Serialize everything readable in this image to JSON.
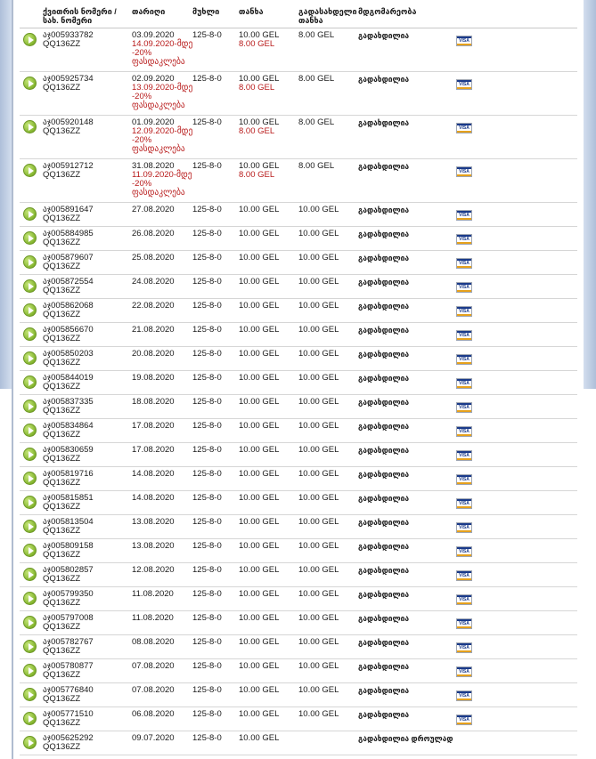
{
  "headers": {
    "number": "ქვითრის ნომერი /",
    "number2": "სახ. ნომერი",
    "date": "თარიღი",
    "route": "მუხლი",
    "amount": "თანხა",
    "paid": "გადასახდელი",
    "paid2": "თანხა",
    "status": "მდგომარეობა"
  },
  "rows": [
    {
      "receipt": "აჯ005933782",
      "plate": "QQ136ZZ",
      "date": "03.09.2020",
      "discount_until": "14.09.2020-მდე",
      "discount": "-20%",
      "discount_label": "ფასდაკლება",
      "route": "125-8-0",
      "amount": "10.00 GEL",
      "discounted_amount": "8.00 GEL",
      "paid": "8.00 GEL",
      "status": "გადახდილია",
      "card": "VISA"
    },
    {
      "receipt": "აჯ005925734",
      "plate": "QQ136ZZ",
      "date": "02.09.2020",
      "discount_until": "13.09.2020-მდე",
      "discount": "-20%",
      "discount_label": "ფასდაკლება",
      "route": "125-8-0",
      "amount": "10.00 GEL",
      "discounted_amount": "8.00 GEL",
      "paid": "8.00 GEL",
      "status": "გადახდილია",
      "card": "VISA"
    },
    {
      "receipt": "აჯ005920148",
      "plate": "QQ136ZZ",
      "date": "01.09.2020",
      "discount_until": "12.09.2020-მდე",
      "discount": "-20%",
      "discount_label": "ფასდაკლება",
      "route": "125-8-0",
      "amount": "10.00 GEL",
      "discounted_amount": "8.00 GEL",
      "paid": "8.00 GEL",
      "status": "გადახდილია",
      "card": "VISA"
    },
    {
      "receipt": "აჯ005912712",
      "plate": "QQ136ZZ",
      "date": "31.08.2020",
      "discount_until": "11.09.2020-მდე",
      "discount": "-20%",
      "discount_label": "ფასდაკლება",
      "route": "125-8-0",
      "amount": "10.00 GEL",
      "discounted_amount": "8.00 GEL",
      "paid": "8.00 GEL",
      "status": "გადახდილია",
      "card": "VISA"
    },
    {
      "receipt": "აჯ005891647",
      "plate": "QQ136ZZ",
      "date": "27.08.2020",
      "route": "125-8-0",
      "amount": "10.00 GEL",
      "paid": "10.00 GEL",
      "status": "გადახდილია",
      "card": "VISA"
    },
    {
      "receipt": "აჯ005884985",
      "plate": "QQ136ZZ",
      "date": "26.08.2020",
      "route": "125-8-0",
      "amount": "10.00 GEL",
      "paid": "10.00 GEL",
      "status": "გადახდილია",
      "card": "VISA"
    },
    {
      "receipt": "აჯ005879607",
      "plate": "QQ136ZZ",
      "date": "25.08.2020",
      "route": "125-8-0",
      "amount": "10.00 GEL",
      "paid": "10.00 GEL",
      "status": "გადახდილია",
      "card": "VISA"
    },
    {
      "receipt": "აჯ005872554",
      "plate": "QQ136ZZ",
      "date": "24.08.2020",
      "route": "125-8-0",
      "amount": "10.00 GEL",
      "paid": "10.00 GEL",
      "status": "გადახდილია",
      "card": "VISA"
    },
    {
      "receipt": "აჯ005862068",
      "plate": "QQ136ZZ",
      "date": "22.08.2020",
      "route": "125-8-0",
      "amount": "10.00 GEL",
      "paid": "10.00 GEL",
      "status": "გადახდილია",
      "card": "VISA"
    },
    {
      "receipt": "აჯ005856670",
      "plate": "QQ136ZZ",
      "date": "21.08.2020",
      "route": "125-8-0",
      "amount": "10.00 GEL",
      "paid": "10.00 GEL",
      "status": "გადახდილია",
      "card": "VISA"
    },
    {
      "receipt": "აჯ005850203",
      "plate": "QQ136ZZ",
      "date": "20.08.2020",
      "route": "125-8-0",
      "amount": "10.00 GEL",
      "paid": "10.00 GEL",
      "status": "გადახდილია",
      "card": "VISA"
    },
    {
      "receipt": "აჯ005844019",
      "plate": "QQ136ZZ",
      "date": "19.08.2020",
      "route": "125-8-0",
      "amount": "10.00 GEL",
      "paid": "10.00 GEL",
      "status": "გადახდილია",
      "card": "VISA"
    },
    {
      "receipt": "აჯ005837335",
      "plate": "QQ136ZZ",
      "date": "18.08.2020",
      "route": "125-8-0",
      "amount": "10.00 GEL",
      "paid": "10.00 GEL",
      "status": "გადახდილია",
      "card": "VISA"
    },
    {
      "receipt": "აჯ005834864",
      "plate": "QQ136ZZ",
      "date": "17.08.2020",
      "route": "125-8-0",
      "amount": "10.00 GEL",
      "paid": "10.00 GEL",
      "status": "გადახდილია",
      "card": "VISA"
    },
    {
      "receipt": "აჯ005830659",
      "plate": "QQ136ZZ",
      "date": "17.08.2020",
      "route": "125-8-0",
      "amount": "10.00 GEL",
      "paid": "10.00 GEL",
      "status": "გადახდილია",
      "card": "VISA"
    },
    {
      "receipt": "აჯ005819716",
      "plate": "QQ136ZZ",
      "date": "14.08.2020",
      "route": "125-8-0",
      "amount": "10.00 GEL",
      "paid": "10.00 GEL",
      "status": "გადახდილია",
      "card": "VISA"
    },
    {
      "receipt": "აჯ005815851",
      "plate": "QQ136ZZ",
      "date": "14.08.2020",
      "route": "125-8-0",
      "amount": "10.00 GEL",
      "paid": "10.00 GEL",
      "status": "გადახდილია",
      "card": "VISA"
    },
    {
      "receipt": "აჯ005813504",
      "plate": "QQ136ZZ",
      "date": "13.08.2020",
      "route": "125-8-0",
      "amount": "10.00 GEL",
      "paid": "10.00 GEL",
      "status": "გადახდილია",
      "card": "VISA"
    },
    {
      "receipt": "აჯ005809158",
      "plate": "QQ136ZZ",
      "date": "13.08.2020",
      "route": "125-8-0",
      "amount": "10.00 GEL",
      "paid": "10.00 GEL",
      "status": "გადახდილია",
      "card": "VISA"
    },
    {
      "receipt": "აჯ005802857",
      "plate": "QQ136ZZ",
      "date": "12.08.2020",
      "route": "125-8-0",
      "amount": "10.00 GEL",
      "paid": "10.00 GEL",
      "status": "გადახდილია",
      "card": "VISA"
    },
    {
      "receipt": "აჯ005799350",
      "plate": "QQ136ZZ",
      "date": "11.08.2020",
      "route": "125-8-0",
      "amount": "10.00 GEL",
      "paid": "10.00 GEL",
      "status": "გადახდილია",
      "card": "VISA"
    },
    {
      "receipt": "აჯ005797008",
      "plate": "QQ136ZZ",
      "date": "11.08.2020",
      "route": "125-8-0",
      "amount": "10.00 GEL",
      "paid": "10.00 GEL",
      "status": "გადახდილია",
      "card": "VISA"
    },
    {
      "receipt": "აჯ005782767",
      "plate": "QQ136ZZ",
      "date": "08.08.2020",
      "route": "125-8-0",
      "amount": "10.00 GEL",
      "paid": "10.00 GEL",
      "status": "გადახდილია",
      "card": "VISA"
    },
    {
      "receipt": "აჯ005780877",
      "plate": "QQ136ZZ",
      "date": "07.08.2020",
      "route": "125-8-0",
      "amount": "10.00 GEL",
      "paid": "10.00 GEL",
      "status": "გადახდილია",
      "card": "VISA"
    },
    {
      "receipt": "აჯ005776840",
      "plate": "QQ136ZZ",
      "date": "07.08.2020",
      "route": "125-8-0",
      "amount": "10.00 GEL",
      "paid": "10.00 GEL",
      "status": "გადახდილია",
      "card": "VISA"
    },
    {
      "receipt": "აჯ005771510",
      "plate": "QQ136ZZ",
      "date": "06.08.2020",
      "route": "125-8-0",
      "amount": "10.00 GEL",
      "paid": "10.00 GEL",
      "status": "გადახდილია",
      "card": "VISA"
    },
    {
      "receipt": "აჯ005625292",
      "plate": "QQ136ZZ",
      "date": "09.07.2020",
      "route": "125-8-0",
      "amount": "10.00 GEL",
      "paid": "",
      "status": "გადახდილია დროულად",
      "card": ""
    }
  ]
}
